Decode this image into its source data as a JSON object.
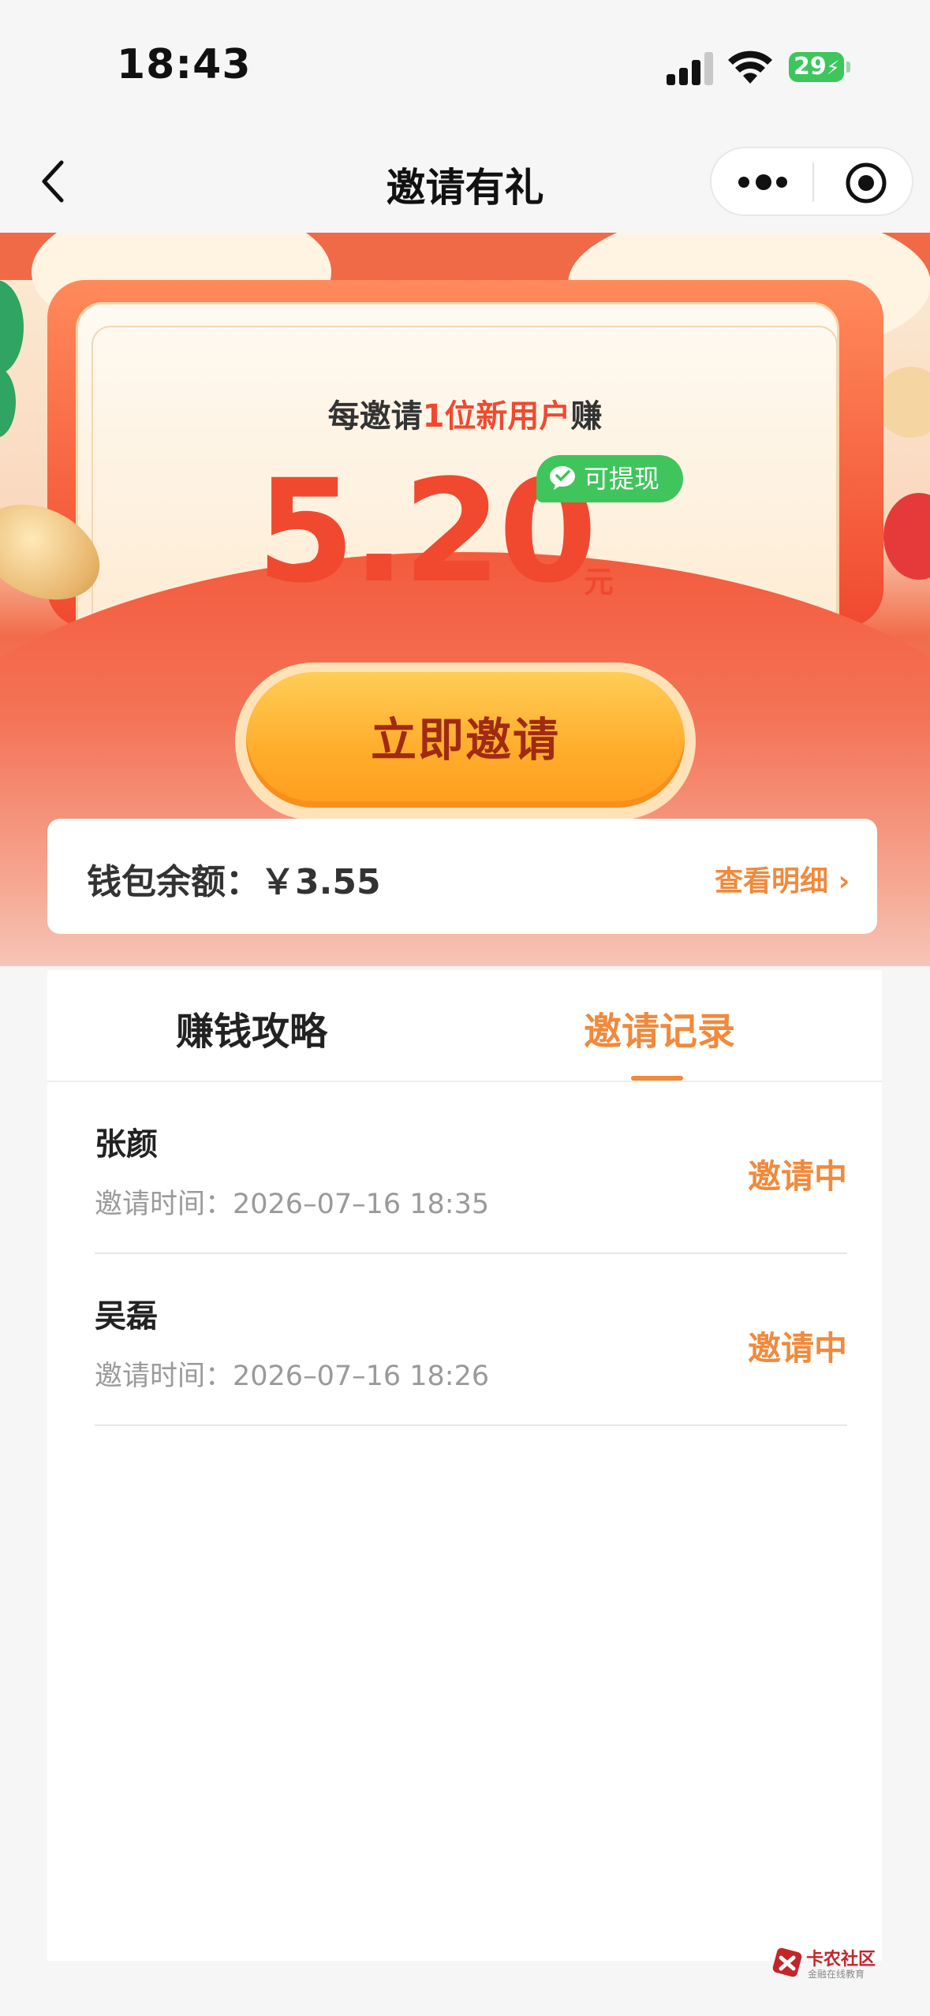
{
  "status_bar": {
    "time": "18:43",
    "battery": "29"
  },
  "nav": {
    "title": "邀请有礼"
  },
  "hero": {
    "headline_prefix": "每邀请",
    "headline_highlight": "1位新用户",
    "headline_suffix": "赚",
    "amount": "5.20",
    "unit": "元",
    "badge": "可提现",
    "invite_button": "立即邀请"
  },
  "wallet": {
    "label": "钱包余额：￥3.55",
    "details_link": "查看明细 ›"
  },
  "tabs": [
    {
      "label": "赚钱攻略",
      "active": false
    },
    {
      "label": "邀请记录",
      "active": true
    }
  ],
  "records": [
    {
      "name": "张颜",
      "time": "邀请时间：2026–07–16 18:35",
      "status": "邀请中"
    },
    {
      "name": "吴磊",
      "time": "邀请时间：2026–07–16 18:26",
      "status": "邀请中"
    }
  ],
  "watermark": {
    "title": "卡农社区",
    "subtitle": "金融在线教育"
  },
  "colors": {
    "accent": "#f08a3c",
    "red": "#f0492f",
    "green": "#3fc55c",
    "button": "#ffae2d"
  }
}
